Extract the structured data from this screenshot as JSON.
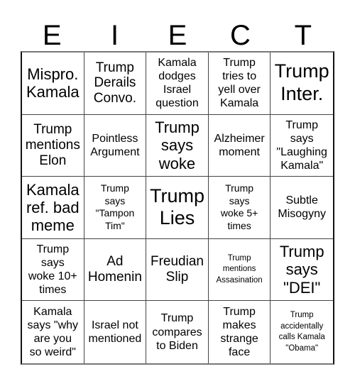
{
  "header": {
    "letters": [
      "E",
      "I",
      "E",
      "C",
      "T"
    ]
  },
  "cells": [
    "Mispro. Kamala",
    "Trump Derails Convo.",
    "Kamala dodges Israel question",
    "Trump tries to yell over Kamala",
    "Trump Inter.",
    "Trump mentions Elon",
    "Pointless Argument",
    "Trump says woke",
    "Alzheimer moment",
    "Trump says \"Laughing Kamala\"",
    "Kamala ref. bad meme",
    "Trump says \"Tampon Tim\"",
    "Trump Lies",
    "Trump says woke 5+ times",
    "Subtle Misogyny",
    "Trump says woke 10+ times",
    "Ad Homenin",
    "Freudian Slip",
    "Trump mentions Assasination",
    "Trump says \"DEI\"",
    "Kamala says \"why are you so weird\"",
    "Israel not mentioned",
    "Trump compares to Biden",
    "Trump makes strange face",
    "Trump accidentally calls Kamala \"Obama\""
  ],
  "cell_lines": [
    [
      "Mispro.",
      "Kamala"
    ],
    [
      "Trump",
      "Derails",
      "Convo."
    ],
    [
      "Kamala",
      "dodges",
      "Israel",
      "question"
    ],
    [
      "Trump",
      "tries to",
      "yell over",
      "Kamala"
    ],
    [
      "Trump",
      "Inter."
    ],
    [
      "Trump",
      "mentions",
      "Elon"
    ],
    [
      "Pointless",
      "Argument"
    ],
    [
      "Trump",
      "says",
      "woke"
    ],
    [
      "Alzheimer",
      "moment"
    ],
    [
      "Trump",
      "says",
      "\"Laughing",
      "Kamala\""
    ],
    [
      "Kamala",
      "ref. bad",
      "meme"
    ],
    [
      "Trump",
      "says",
      "\"Tampon",
      "Tim\""
    ],
    [
      "Trump",
      "Lies"
    ],
    [
      "Trump",
      "says",
      "woke 5+",
      "times"
    ],
    [
      "Subtle",
      "Misogyny"
    ],
    [
      "Trump",
      "says",
      "woke 10+",
      "times"
    ],
    [
      "Ad",
      "Homenin"
    ],
    [
      "Freudian",
      "Slip"
    ],
    [
      "Trump",
      "mentions",
      "Assasination"
    ],
    [
      "Trump",
      "says",
      "\"DEI\""
    ],
    [
      "Kamala",
      "says \"why",
      "are you",
      "so weird\""
    ],
    [
      "Israel not",
      "mentioned"
    ],
    [
      "Trump",
      "compares",
      "to Biden"
    ],
    [
      "Trump",
      "makes",
      "strange",
      "face"
    ],
    [
      "Trump",
      "accidentally",
      "calls Kamala",
      "\"Obama\""
    ]
  ]
}
